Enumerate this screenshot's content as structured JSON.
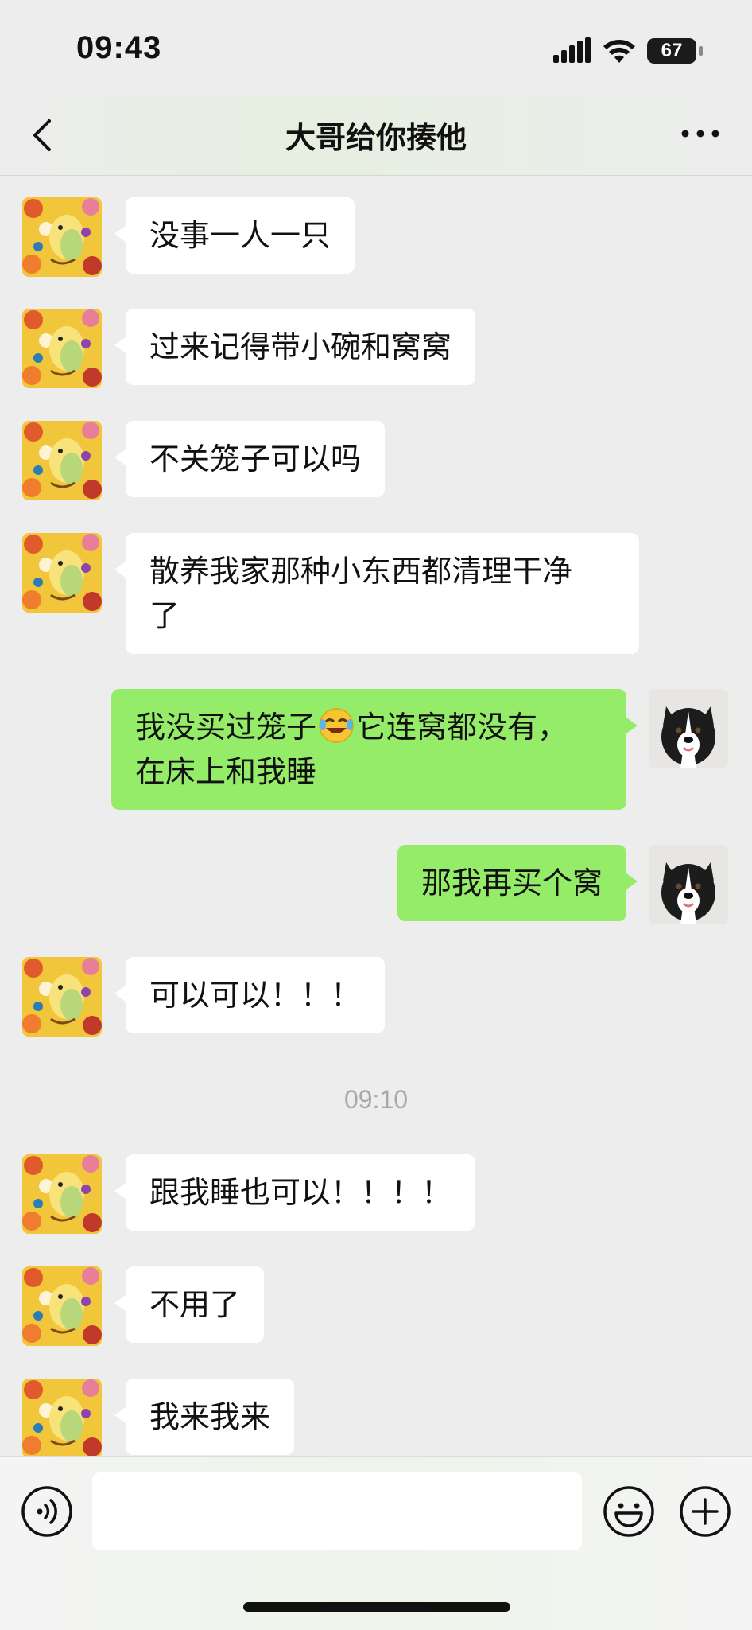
{
  "status_bar": {
    "time": "09:43",
    "battery": "67",
    "signal_icon": "cellular-signal-icon",
    "wifi_icon": "wifi-icon"
  },
  "header": {
    "title": "大哥给你揍他",
    "back_icon": "chevron-left-icon",
    "more_icon": "more-dots-icon"
  },
  "messages": [
    {
      "side": "in",
      "text": "没事一人一只"
    },
    {
      "side": "in",
      "text": "过来记得带小碗和窝窝"
    },
    {
      "side": "in",
      "text": "不关笼子可以吗"
    },
    {
      "side": "in",
      "text": "散养我家那种小东西都清理干净\n了"
    },
    {
      "side": "out",
      "text_before_emoji": "我没买过笼子",
      "emoji": "laughing-crying-emoji",
      "text_after_emoji": "它连窝都没有，\n在床上和我睡"
    },
    {
      "side": "out",
      "text": "那我再买个窝"
    },
    {
      "side": "in",
      "text": "可以可以！！！"
    },
    {
      "timestamp": "09:10"
    },
    {
      "side": "in",
      "text": "跟我睡也可以！！！！"
    },
    {
      "side": "in",
      "text": "不用了"
    },
    {
      "side": "in",
      "text": "我来我来"
    }
  ],
  "input_bar": {
    "value": "",
    "voice_icon": "voice-icon",
    "emoji_icon": "emoji-icon",
    "plus_icon": "plus-icon"
  },
  "colors": {
    "background": "#ededed",
    "incoming_bubble": "#ffffff",
    "outgoing_bubble": "#95ec69",
    "timestamp": "#a8a8a8"
  }
}
